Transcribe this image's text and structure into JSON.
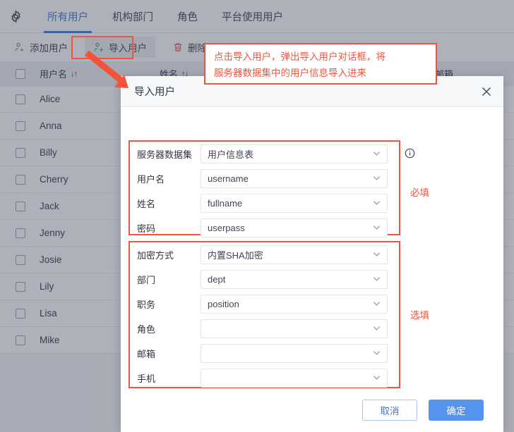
{
  "header": {
    "gear_icon": "gear-icon",
    "tabs": [
      {
        "label": "所有用户",
        "active": true
      },
      {
        "label": "机构部门",
        "active": false
      },
      {
        "label": "角色",
        "active": false
      },
      {
        "label": "平台使用用户",
        "active": false
      }
    ]
  },
  "toolbar": {
    "add_user": "添加用户",
    "import_user": "导入用户",
    "delete_user": "删除用户",
    "add_icon": "user-add-icon",
    "import_icon": "user-import-icon",
    "delete_icon": "trash-icon"
  },
  "table": {
    "columns": {
      "username": "用户名",
      "username_sort": "↓↑",
      "fullname": "姓名",
      "fullname_sort": "↑↓",
      "email": "邮箱"
    },
    "rows": [
      {
        "username": "Alice"
      },
      {
        "username": "Anna"
      },
      {
        "username": "Billy"
      },
      {
        "username": "Cherry"
      },
      {
        "username": "Jack"
      },
      {
        "username": "Jenny"
      },
      {
        "username": "Josie"
      },
      {
        "username": "Lily"
      },
      {
        "username": "Lisa"
      },
      {
        "username": "Mike"
      }
    ]
  },
  "callout": {
    "line1": "点击导入用户，弹出导入用户对话框，将",
    "line2": "服务器数据集中的用户信息导入进来",
    "color": "#f4533a"
  },
  "dialog": {
    "title": "导入用户",
    "close_icon": "close-icon",
    "info_icon": "info-circle-icon",
    "required_label": "必填",
    "optional_label": "选填",
    "required_fields": [
      {
        "label": "服务器数据集",
        "value": "用户信息表"
      },
      {
        "label": "用户名",
        "value": "username"
      },
      {
        "label": "姓名",
        "value": "fullname"
      },
      {
        "label": "密码",
        "value": "userpass"
      }
    ],
    "optional_fields": [
      {
        "label": "加密方式",
        "value": "内置SHA加密"
      },
      {
        "label": "部门",
        "value": "dept"
      },
      {
        "label": "职务",
        "value": "position"
      },
      {
        "label": "角色",
        "value": ""
      },
      {
        "label": "邮箱",
        "value": ""
      },
      {
        "label": "手机",
        "value": ""
      }
    ],
    "cancel_label": "取消",
    "confirm_label": "确定",
    "accent_color": "#5693ef"
  }
}
